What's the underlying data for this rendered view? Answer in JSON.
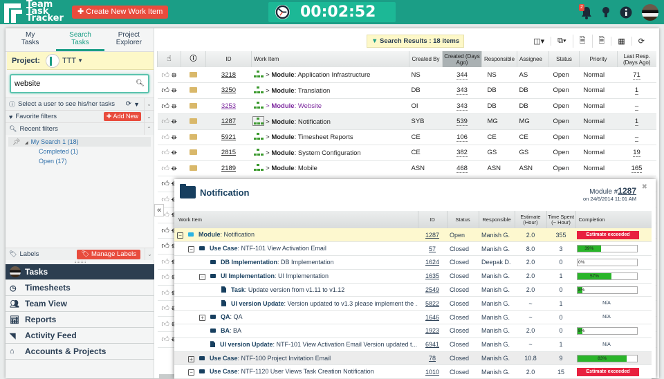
{
  "app": {
    "title_lines": [
      "Team",
      "Task",
      "Tracker"
    ],
    "create_button": "Create New Work Item",
    "timer": "00:02:52",
    "notification_count": "2"
  },
  "left_tabs": [
    {
      "label_1": "My",
      "label_2": "Tasks"
    },
    {
      "label_1": "Search",
      "label_2": "Tasks",
      "active": true
    },
    {
      "label_1": "Project",
      "label_2": "Explorer"
    }
  ],
  "project": {
    "label": "Project:",
    "name": "TTT"
  },
  "search": {
    "value": "website",
    "placeholder": ""
  },
  "sections": {
    "select_user": "Select a user to see his/her tasks",
    "favorite_filters": "Favorite filters",
    "add_new": "Add New",
    "recent_filters": "Recent filters",
    "labels": "Labels",
    "manage_labels": "Manage Labels"
  },
  "recent_tree": {
    "root": "My Search 1 (18)",
    "children": [
      "Completed (1)",
      "Open (17)"
    ]
  },
  "nav": [
    {
      "label": "Tasks",
      "icon": "avatar-icon",
      "active": true
    },
    {
      "label": "Timesheets",
      "icon": "clock-icon"
    },
    {
      "label": "Team View",
      "icon": "users-icon"
    },
    {
      "label": "Reports",
      "icon": "bar-chart-icon"
    },
    {
      "label": "Activity Feed",
      "icon": "rss-icon"
    },
    {
      "label": "Accounts & Projects",
      "icon": "home-icon"
    }
  ],
  "toolbar": {
    "results": "Search Results : 18 items"
  },
  "grid": {
    "headers": [
      "",
      "",
      "ID",
      "Work Item",
      "Created By",
      "Created (Days Ago)",
      "Responsible",
      "Assignee",
      "Status",
      "Priority",
      "Last Resp. (Days Ago)"
    ],
    "rows": [
      {
        "id": "3218",
        "type": "Module",
        "name": "Application Infrastructure",
        "created_by": "NS",
        "created": "344",
        "responsible": "NS",
        "assignee": "AS",
        "status": "Open",
        "priority": "Normal",
        "last": "71"
      },
      {
        "id": "3250",
        "type": "Module",
        "name": "Translation",
        "created_by": "DB",
        "created": "343",
        "responsible": "DB",
        "assignee": "DB",
        "status": "Open",
        "priority": "Normal",
        "last": "1"
      },
      {
        "id": "3253",
        "type": "Module",
        "name": "Website",
        "created_by": "OI",
        "created": "343",
        "responsible": "DB",
        "assignee": "DB",
        "status": "Open",
        "priority": "Normal",
        "last": "–"
      },
      {
        "id": "1287",
        "type": "Module",
        "name": "Notification",
        "created_by": "SYB",
        "created": "539",
        "responsible": "MG",
        "assignee": "MG",
        "status": "Open",
        "priority": "Normal",
        "last": "1"
      },
      {
        "id": "5921",
        "type": "Module",
        "name": "Timesheet Reports",
        "created_by": "CE",
        "created": "106",
        "responsible": "CE",
        "assignee": "CE",
        "status": "Open",
        "priority": "Normal",
        "last": "–"
      },
      {
        "id": "2815",
        "type": "Module",
        "name": "System Configuration",
        "created_by": "CE",
        "created": "382",
        "responsible": "GS",
        "assignee": "GS",
        "status": "Open",
        "priority": "Normal",
        "last": "19"
      },
      {
        "id": "2189",
        "type": "Module",
        "name": "Mobile",
        "created_by": "ASN",
        "created": "468",
        "responsible": "ASN",
        "assignee": "ASN",
        "status": "Open",
        "priority": "Normal",
        "last": "165"
      }
    ]
  },
  "popup": {
    "title": "Notification",
    "meta_prefix": "Module #",
    "meta_id": "1287",
    "meta_date": "on 24/6/2014 11:01 AM",
    "headers": [
      "Work Item",
      "ID",
      "Status",
      "Responsible",
      "Estimate (Hour)",
      "Time Spent (~ Hour)",
      "Completion"
    ],
    "rows": [
      {
        "type": "Module",
        "name": "Notification",
        "id": "1287",
        "status": "Open",
        "responsible": "Manish G.",
        "estimate": "2.0",
        "spent": "355",
        "completion": "Estimate exceeded"
      },
      {
        "type": "Use Case",
        "name": "NTF-101 View Activation Email",
        "id": "57",
        "status": "Closed",
        "responsible": "Manish G.",
        "estimate": "8.0",
        "spent": "3",
        "completion": "39%",
        "pct": 39
      },
      {
        "type": "DB Implementation",
        "name": "DB Implementation",
        "id": "1624",
        "status": "Closed",
        "responsible": "Deepak D.",
        "estimate": "2.0",
        "spent": "0",
        "completion": "0%",
        "pct": 0
      },
      {
        "type": "UI Implementation",
        "name": "UI Implementation",
        "id": "1635",
        "status": "Closed",
        "responsible": "Manish G.",
        "estimate": "2.0",
        "spent": "1",
        "completion": "57%",
        "pct": 57
      },
      {
        "type": "Task",
        "name": "Update version from v1.11 to v1.12",
        "id": "2549",
        "status": "Closed",
        "responsible": "Manish G.",
        "estimate": "2.0",
        "spent": "0",
        "completion": "8%",
        "pct": 8
      },
      {
        "type": "UI version Update",
        "name": "Version updated to v1.3 please implement the ...",
        "id": "5822",
        "status": "Closed",
        "responsible": "Manish G.",
        "estimate": "~",
        "spent": "1",
        "completion": "N/A"
      },
      {
        "type": "QA",
        "name": "QA",
        "id": "1646",
        "status": "Closed",
        "responsible": "Manish G.",
        "estimate": "~",
        "spent": "0",
        "completion": "N/A"
      },
      {
        "type": "BA",
        "name": "BA",
        "id": "1923",
        "status": "Closed",
        "responsible": "Manish G.",
        "estimate": "2.0",
        "spent": "0",
        "completion": "8%",
        "pct": 8
      },
      {
        "type": "UI version Update",
        "name": "NTF-101 View Activation Email Version updated t...",
        "id": "6941",
        "status": "Closed",
        "responsible": "Manish G.",
        "estimate": "~",
        "spent": "1",
        "completion": "N/A"
      },
      {
        "type": "Use Case",
        "name": "NTF-100 Project Invitation Email",
        "id": "78",
        "status": "Closed",
        "responsible": "Manish G.",
        "estimate": "10.8",
        "spent": "9",
        "completion": "83%",
        "pct": 83
      },
      {
        "type": "Use Case",
        "name": "NTF-1120 User Views Task Creation Notification",
        "id": "1010",
        "status": "Closed",
        "responsible": "Manish G.",
        "estimate": "2.0",
        "spent": "15",
        "completion": "Estimate exceeded"
      }
    ]
  }
}
